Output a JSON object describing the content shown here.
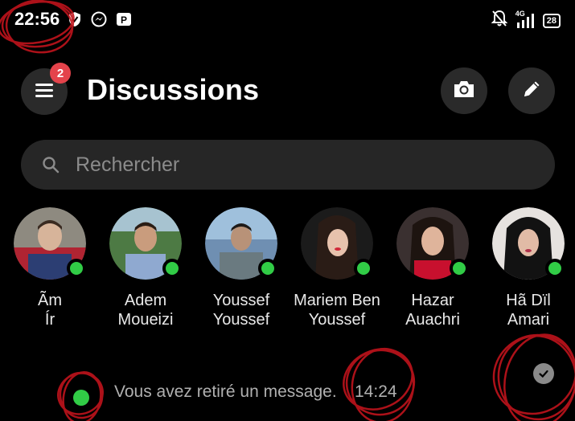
{
  "status_bar": {
    "time": "22:56",
    "network": "4G",
    "battery": "28",
    "icons": [
      "shield-icon",
      "messenger-icon",
      "app-icon",
      "bell-muted-icon",
      "signal-icon",
      "battery-icon"
    ]
  },
  "header": {
    "title": "Discussions",
    "menu_badge": "2",
    "icons": [
      "hamburger-menu-icon",
      "camera-icon",
      "pencil-icon"
    ]
  },
  "search": {
    "placeholder": "Rechercher"
  },
  "stories": [
    {
      "line1": "Ãm",
      "line2": "Ír",
      "online": true
    },
    {
      "line1": "Adem",
      "line2": "Moueizi",
      "online": true
    },
    {
      "line1": "Youssef",
      "line2": "Youssef",
      "online": true
    },
    {
      "line1": "Mariem Ben",
      "line2": "Youssef",
      "online": true
    },
    {
      "line1": "Hazar",
      "line2": "Auachri",
      "online": true
    },
    {
      "line1": "Hã Dïl",
      "line2": "Amari",
      "online": true
    }
  ],
  "message": {
    "preview": "Vous avez retiré un message.",
    "time": "14:24",
    "status": "seen"
  },
  "colors": {
    "background": "#000000",
    "button_bg": "#2a2a2a",
    "search_bg": "#262626",
    "online": "#31cc46",
    "badge": "#e4434b",
    "annotation": "#c0141c"
  }
}
